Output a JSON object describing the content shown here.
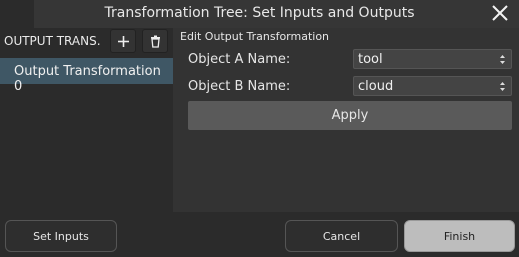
{
  "window": {
    "title": "Transformation Tree: Set Inputs and Outputs",
    "close_icon": "close-icon"
  },
  "left_panel": {
    "header_label": "OUTPUT TRANS.",
    "add_icon": "plus-icon",
    "delete_icon": "trash-icon",
    "items": [
      {
        "label": "Output Transformation 0",
        "selected": true
      }
    ]
  },
  "editor": {
    "section_title": "Edit Output Transformation",
    "object_a_label": "Object A Name:",
    "object_a_value": "tool",
    "object_b_label": "Object B Name:",
    "object_b_value": "cloud",
    "apply_label": "Apply"
  },
  "footer": {
    "set_inputs_label": "Set Inputs",
    "cancel_label": "Cancel",
    "finish_label": "Finish"
  },
  "colors": {
    "selection": "#3f5765",
    "apply_button": "#5a5a5a",
    "finish_button": "#bdbdbd"
  }
}
